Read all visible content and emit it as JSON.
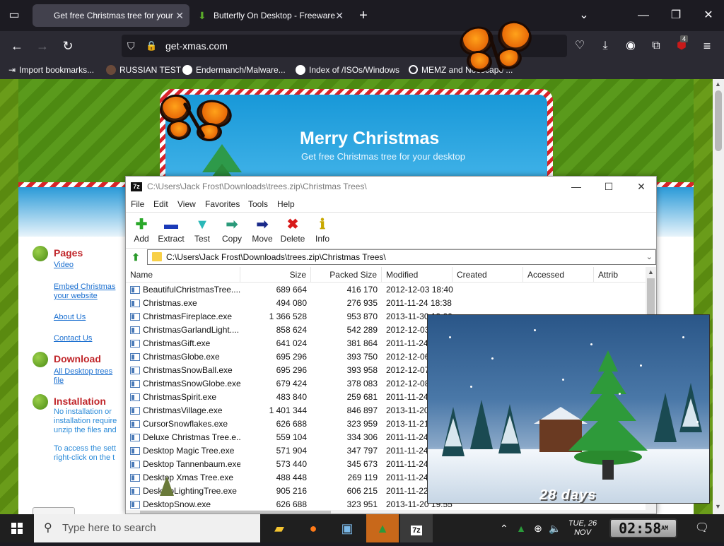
{
  "browser": {
    "tabs": [
      {
        "label": "Get free Christmas tree for your"
      },
      {
        "label": "Butterfly On Desktop - Freeware"
      }
    ],
    "url": "get-xmas.com",
    "bookmarks": [
      {
        "label": "Import bookmarks..."
      },
      {
        "label": "RUSSIAN TEST"
      },
      {
        "label": "Endermanch/Malware..."
      },
      {
        "label": "Index of /ISOs/Windows"
      },
      {
        "label": "MEMZ and Noescape ..."
      }
    ],
    "notification_count": "4"
  },
  "website": {
    "title": "Merry Christmas",
    "subtitle": "Get free Christmas tree for your desktop",
    "sections": [
      {
        "heading": "Pages"
      },
      {
        "heading": "Download"
      },
      {
        "heading": "Installation"
      }
    ],
    "links": {
      "video": "Video",
      "embed1": "Embed Christmas",
      "embed2": "your website",
      "about": "About Us",
      "contact": "Contact Us",
      "all1": "All Desktop trees",
      "all2": "file"
    },
    "install_text": [
      "No installation or",
      "installation require",
      "unzip the files and"
    ],
    "access_text": [
      "To access the sett",
      "right-click on the t"
    ]
  },
  "zip": {
    "title": "C:\\Users\\Jack Frost\\Downloads\\trees.zip\\Christmas Trees\\",
    "menu": [
      "File",
      "Edit",
      "View",
      "Favorites",
      "Tools",
      "Help"
    ],
    "toolbar": [
      {
        "label": "Add",
        "icon": "plus-icon",
        "glyph": "✚",
        "color": "#2aa82a"
      },
      {
        "label": "Extract",
        "icon": "minus-icon",
        "glyph": "▬",
        "color": "#1a3ab8"
      },
      {
        "label": "Test",
        "icon": "check-icon",
        "glyph": "▼",
        "color": "#2ab8b8"
      },
      {
        "label": "Copy",
        "icon": "arrow-right-icon",
        "glyph": "➡",
        "color": "#2a9a7a"
      },
      {
        "label": "Move",
        "icon": "arrow-right-icon",
        "glyph": "➡",
        "color": "#1a2a8a"
      },
      {
        "label": "Delete",
        "icon": "x-icon",
        "glyph": "✖",
        "color": "#d81a1a"
      },
      {
        "label": "Info",
        "icon": "info-icon",
        "glyph": "ℹ",
        "color": "#c8a800"
      }
    ],
    "address": "C:\\Users\\Jack Frost\\Downloads\\trees.zip\\Christmas Trees\\",
    "columns": [
      "Name",
      "Size",
      "Packed Size",
      "Modified",
      "Created",
      "Accessed",
      "Attrib"
    ],
    "rows": [
      {
        "name": "BeautifulChristmasTree....",
        "size": "689 664",
        "packed": "416 170",
        "modified": "2012-12-03 18:40"
      },
      {
        "name": "Christmas.exe",
        "size": "494 080",
        "packed": "276 935",
        "modified": "2011-11-24 18:38"
      },
      {
        "name": "ChristmasFireplace.exe",
        "size": "1 366 528",
        "packed": "953 870",
        "modified": "2013-11-30 19:00"
      },
      {
        "name": "ChristmasGarlandLight....",
        "size": "858 624",
        "packed": "542 289",
        "modified": "2012-12-03"
      },
      {
        "name": "ChristmasGift.exe",
        "size": "641 024",
        "packed": "381 864",
        "modified": "2011-11-24"
      },
      {
        "name": "ChristmasGlobe.exe",
        "size": "695 296",
        "packed": "393 750",
        "modified": "2012-12-06"
      },
      {
        "name": "ChristmasSnowBall.exe",
        "size": "695 296",
        "packed": "393 958",
        "modified": "2012-12-07"
      },
      {
        "name": "ChristmasSnowGlobe.exe",
        "size": "679 424",
        "packed": "378 083",
        "modified": "2012-12-08"
      },
      {
        "name": "ChristmasSpirit.exe",
        "size": "483 840",
        "packed": "259 681",
        "modified": "2011-11-24"
      },
      {
        "name": "ChristmasVillage.exe",
        "size": "1 401 344",
        "packed": "846 897",
        "modified": "2013-11-20"
      },
      {
        "name": "CursorSnowflakes.exe",
        "size": "626 688",
        "packed": "323 959",
        "modified": "2013-11-21"
      },
      {
        "name": "Deluxe Christmas Tree.e...",
        "size": "559 104",
        "packed": "334 306",
        "modified": "2011-11-24"
      },
      {
        "name": "Desktop Magic Tree.exe",
        "size": "571 904",
        "packed": "347 797",
        "modified": "2011-11-24"
      },
      {
        "name": "Desktop Tannenbaum.exe",
        "size": "573 440",
        "packed": "345 673",
        "modified": "2011-11-24"
      },
      {
        "name": "Desktop Xmas Tree.exe",
        "size": "488 448",
        "packed": "269 119",
        "modified": "2011-11-24"
      },
      {
        "name": "DesktopLightingTree.exe",
        "size": "905 216",
        "packed": "606 215",
        "modified": "2011-11-22"
      },
      {
        "name": "DesktopSnow.exe",
        "size": "626 688",
        "packed": "323 951",
        "modified": "2013-11-20 19:55"
      }
    ]
  },
  "snow_widget": {
    "days": "28 days"
  },
  "taskbar": {
    "search_placeholder": "Type here to search",
    "date_day": "TUE, 26",
    "date_month": "NOV",
    "clock": "02:58",
    "clock_ampm": "AM"
  }
}
